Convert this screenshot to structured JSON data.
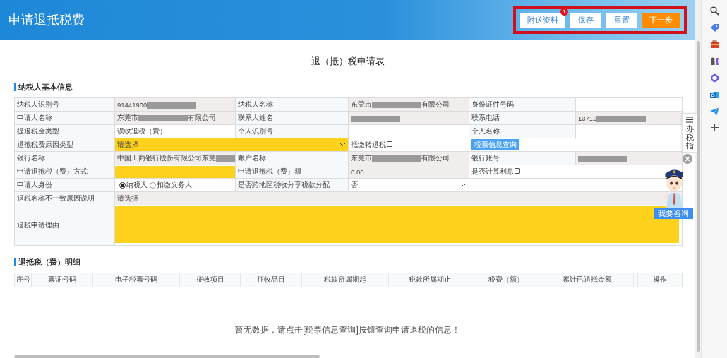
{
  "header": {
    "title": "申请退抵税费",
    "buttons": [
      {
        "label": "附送资料",
        "kind": "plain",
        "badge": "1"
      },
      {
        "label": "保存",
        "kind": "plain"
      },
      {
        "label": "重置",
        "kind": "plain"
      },
      {
        "label": "下一步",
        "kind": "primary"
      }
    ]
  },
  "form_title": "退（抵）税申请表",
  "basic_info": {
    "heading": "纳税人基本信息",
    "rows": [
      [
        {
          "kind": "label",
          "text": "纳税人识别号"
        },
        {
          "kind": "value",
          "text": "91441900",
          "masked": true,
          "readonly": true
        },
        {
          "kind": "label",
          "text": "纳税人名称"
        },
        {
          "kind": "value",
          "text": "东莞市",
          "masked": true,
          "suffix": "有限公司",
          "readonly": true
        },
        {
          "kind": "label",
          "text": "身份证件号码"
        },
        {
          "kind": "value",
          "readonly": false
        }
      ],
      [
        {
          "kind": "label",
          "text": "申请人名称"
        },
        {
          "kind": "value",
          "text": "东莞市",
          "masked": true,
          "suffix": "有限公司",
          "readonly": true
        },
        {
          "kind": "label",
          "text": "联系人姓名"
        },
        {
          "kind": "value",
          "masked": true,
          "readonly": true
        },
        {
          "kind": "label",
          "text": "联系电话"
        },
        {
          "kind": "value",
          "text": "13712",
          "masked": true,
          "readonly": true
        }
      ],
      [
        {
          "kind": "label",
          "text": "提退税金类型"
        },
        {
          "kind": "value",
          "text": "误收退税（费）",
          "readonly": false
        },
        {
          "kind": "label",
          "text": "个人识别号"
        },
        {
          "kind": "value",
          "readonly": false
        },
        {
          "kind": "label",
          "text": "个人名称"
        },
        {
          "kind": "value",
          "readonly": false
        }
      ],
      [
        {
          "kind": "label",
          "text": "退抵税费原因类型"
        },
        {
          "kind": "select",
          "text": "请选择",
          "required": true,
          "colspan": 2
        },
        {
          "kind": "checkbox",
          "text": "抵缴转退税",
          "checked": false
        },
        {
          "kind": "button",
          "text": "税票信息查询",
          "colspan": 2
        }
      ],
      [
        {
          "kind": "label",
          "text": "银行名称"
        },
        {
          "kind": "value",
          "text": "中国工商银行股份有限公司东莞",
          "masked": true,
          "readonly": true
        },
        {
          "kind": "label",
          "text": "账户名称"
        },
        {
          "kind": "value",
          "text": "东莞市",
          "masked": true,
          "suffix": "有限公司",
          "readonly": true
        },
        {
          "kind": "label",
          "text": "银行账号"
        },
        {
          "kind": "value",
          "masked": true,
          "readonly": true
        }
      ],
      [
        {
          "kind": "label",
          "text": "申请退抵税（费）方式"
        },
        {
          "kind": "input",
          "required": true
        },
        {
          "kind": "label",
          "text": "申请退抵税（费）额"
        },
        {
          "kind": "value",
          "text": "0.00",
          "readonly": true
        },
        {
          "kind": "checkbox",
          "text": "是否计算利息",
          "checked": false,
          "colspan": 2
        }
      ],
      [
        {
          "kind": "label",
          "text": "申请人身份"
        },
        {
          "kind": "radio",
          "options": [
            {
              "label": "纳税人",
              "selected": true
            },
            {
              "label": "扣缴义务人",
              "selected": false
            }
          ]
        },
        {
          "kind": "label",
          "text": "是否跨地区税收分享税款分配"
        },
        {
          "kind": "select",
          "text": "否",
          "required": false
        },
        {
          "kind": "value",
          "readonly": false,
          "colspan": 2
        }
      ],
      [
        {
          "kind": "label",
          "text": "退税名称不一致原因说明"
        },
        {
          "kind": "value",
          "text": "请选择",
          "readonly": true,
          "colspan": 5
        }
      ],
      [
        {
          "kind": "label",
          "text": "退税申请理由"
        },
        {
          "kind": "textarea",
          "required": true,
          "colspan": 5
        }
      ]
    ]
  },
  "details": {
    "heading": "退抵税（费）明细",
    "columns": [
      "序号",
      "票证号码",
      "电子税票号码",
      "征收项目",
      "征收品目",
      "税款所属期起",
      "税款所属期止",
      "税费（额）",
      "累计已退抵金额",
      "操作"
    ],
    "empty_message": "暂无数据，请点击[税票信息查询]按钮查询申请退税的信息！"
  },
  "guide_tab": {
    "label": "办税指"
  },
  "assistant": {
    "button": "我要咨询"
  }
}
